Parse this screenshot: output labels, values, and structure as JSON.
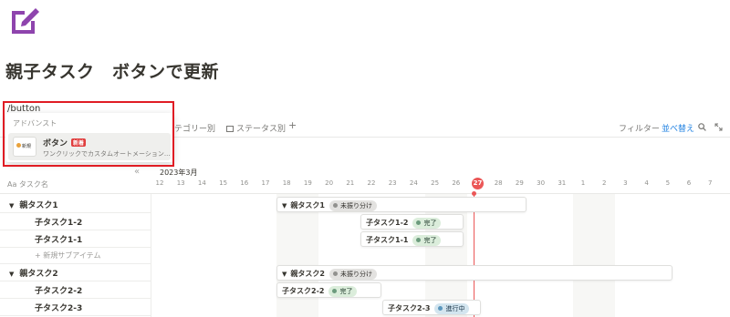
{
  "page": {
    "icon": "edit-square-icon",
    "title": "親子タスク　ボタンで更新",
    "command_text": "/button"
  },
  "dropdown": {
    "section_label": "アドバンスト",
    "item": {
      "thumb_label": "新規",
      "name": "ボタン",
      "badge": "新着",
      "description": "ワンクリックでカスタムオートメーション..."
    }
  },
  "toolbar": {
    "tabs": [
      "カテゴリー別",
      "ステータス別"
    ],
    "add_label": "+",
    "filter_label": "フィルター",
    "sort_label": "並べ替え"
  },
  "timeline": {
    "collapse_label": "«",
    "month_label": "2023年3月",
    "column_header": "Aa タスク名",
    "days": [
      "12",
      "13",
      "14",
      "15",
      "16",
      "17",
      "18",
      "19",
      "20",
      "21",
      "22",
      "23",
      "24",
      "25",
      "26",
      "27",
      "28",
      "29",
      "30",
      "31",
      "1",
      "2",
      "3",
      "4",
      "5",
      "6",
      "7"
    ],
    "today": "27",
    "rows": [
      {
        "label": "親タスク1",
        "parent": true
      },
      {
        "label": "子タスク1-2",
        "parent": false
      },
      {
        "label": "子タスク1-1",
        "parent": false
      },
      {
        "label": "新規サブアイテム",
        "add": true
      },
      {
        "label": "親タスク2",
        "parent": true
      },
      {
        "label": "子タスク2-2",
        "parent": false
      },
      {
        "label": "子タスク2-3",
        "parent": false
      }
    ],
    "bars": [
      {
        "label": "親タスク1",
        "status": "未振り分け",
        "status_color": "gray"
      },
      {
        "label": "子タスク1-2",
        "status": "完了",
        "status_color": "green"
      },
      {
        "label": "子タスク1-1",
        "status": "完了",
        "status_color": "green"
      },
      {
        "label": "親タスク2",
        "status": "未振り分け",
        "status_color": "gray"
      },
      {
        "label": "子タスク2-2",
        "status": "完了",
        "status_color": "green"
      },
      {
        "label": "子タスク2-3",
        "status": "進行中",
        "status_color": "blue"
      }
    ]
  },
  "colors": {
    "accent": "#2383e2",
    "today": "#eb5757",
    "highlight": "#e01c24",
    "icon": "#8e44ad"
  }
}
